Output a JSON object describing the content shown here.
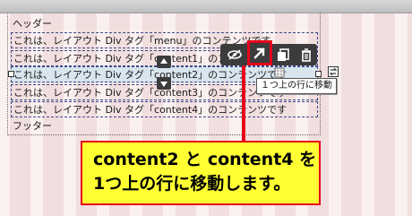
{
  "rows": [
    {
      "label": "ヘッダー"
    },
    {
      "label": "これは、レイアウト Div タグ「menu」のコンテンツです"
    },
    {
      "label": "これは、レイアウト Div タグ「content1」のコンテンツです"
    },
    {
      "label": "これは、レイアウト Div タグ「content2」のコンテンツです"
    },
    {
      "label": "これは、レイアウト Div タグ「content3」のコンテンツです"
    },
    {
      "label": "これは、レイアウト Div タグ「content4」のコンテンツです"
    },
    {
      "label": "フッター"
    }
  ],
  "toolbar": {
    "icons": [
      "eye-slash-icon",
      "move-up-icon",
      "duplicate-icon",
      "trash-icon"
    ],
    "tooltip": "１つ上の行に移動"
  },
  "callout": {
    "line1": "content2 と content4 を",
    "line2": "1つ上の行に移動します。"
  },
  "colors": {
    "accent": "#e6001a",
    "callout_bg": "#ffff33",
    "selection": "#d8e5ee"
  }
}
